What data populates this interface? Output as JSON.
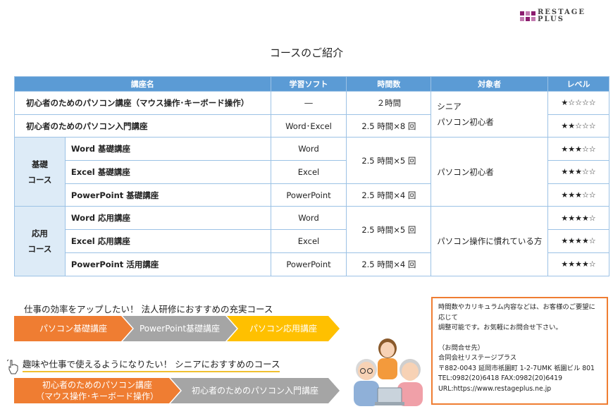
{
  "logo": {
    "line1": "RESTAGE",
    "line2": "PLUS"
  },
  "page_title": "コースのご紹介",
  "table": {
    "headers": [
      "講座名",
      "学習ソフト",
      "時間数",
      "対象者",
      "レベル"
    ],
    "rows": [
      {
        "name": "初心者のためのパソコン講座（マウス操作･キーボード操作）",
        "software": "―",
        "hours": "２時間",
        "stars": "★☆☆☆☆"
      },
      {
        "name": "初心者のためのパソコン入門講座",
        "software": "Word･Excel",
        "hours": "2.5 時間×8 回",
        "stars": "★★☆☆☆"
      },
      {
        "name": "Word 基礎講座",
        "software": "Word",
        "stars": "★★★☆☆"
      },
      {
        "name": "Excel 基礎講座",
        "software": "Excel",
        "stars": "★★★☆☆"
      },
      {
        "name": "PowerPoint 基礎講座",
        "software": "PowerPoint",
        "hours": "2.5 時間×4 回",
        "stars": "★★★☆☆"
      },
      {
        "name": "Word 応用講座",
        "software": "Word",
        "stars": "★★★★☆"
      },
      {
        "name": "Excel 応用講座",
        "software": "Excel",
        "stars": "★★★★☆"
      },
      {
        "name": "PowerPoint 活用講座",
        "software": "PowerPoint",
        "hours": "2.5 時間×4 回",
        "stars": "★★★★☆"
      }
    ],
    "basic_group": {
      "line1": "基礎",
      "line2": "コース",
      "hours": "2.5 時間×5 回",
      "target": "パソコン初心者"
    },
    "advanced_group": {
      "line1": "応用",
      "line2": "コース",
      "hours": "2.5 時間×5 回",
      "target": "パソコン操作に慣れている方"
    },
    "beginner_target": {
      "line1": "シニア",
      "line2": "パソコン初心者"
    }
  },
  "flow1": {
    "title": "仕事の効率をアップしたい！ 法人研修におすすめの充実コース",
    "steps": [
      "パソコン基礎講座",
      "PowerPoint基礎講座",
      "パソコン応用講座"
    ]
  },
  "flow2": {
    "title": "趣味や仕事で使えるようになりたい！ シニアにおすすめのコース",
    "step1_line1": "初心者のためのパソコン講座",
    "step1_line2": "（マウス操作･キーボード操作）",
    "step2": "初心者のためのパソコン入門講座"
  },
  "contact": {
    "note1": "時間数やカリキュラム内容などは、お客様のご要望に応じて",
    "note2": "調整可能です。お気軽にお問合せ下さい。",
    "label": "（お問合せ先）",
    "company": "合同会社リステージプラス",
    "address": "〒882-0043 延岡市祇園町 1-2-7UMK 祇園ビル 801",
    "tel_fax": "TEL:0982(20)6418 FAX:0982(20)6419",
    "url": "URL:https://www.restageplus.ne.jp"
  },
  "colors": {
    "header_blue": "#5b9bd5",
    "group_bg": "#ddebf7",
    "orange": "#ef7d32",
    "gray": "#a5a5a5",
    "yellow": "#ffc000",
    "logo_purple": "#8b1d6e"
  },
  "icons": [
    "pointing-hand-icon",
    "seniors-illustration"
  ]
}
